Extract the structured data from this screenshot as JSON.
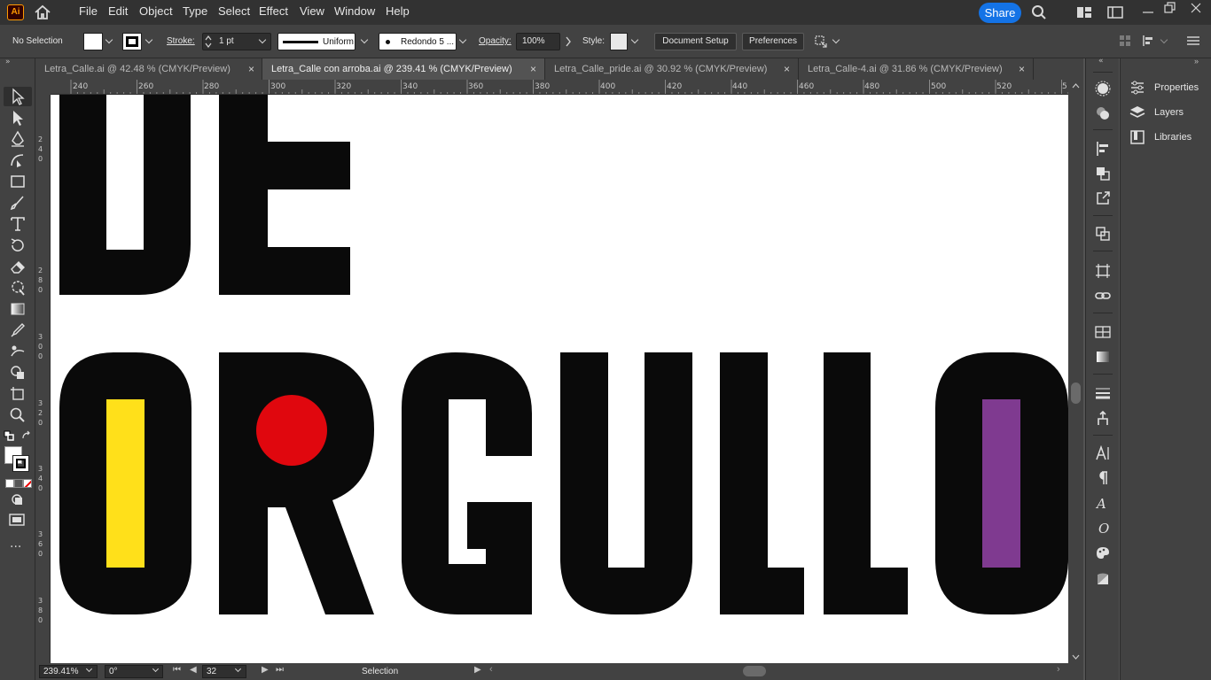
{
  "app": {
    "logo_text": "Ai"
  },
  "menu": [
    "File",
    "Edit",
    "Object",
    "Type",
    "Select",
    "Effect",
    "View",
    "Window",
    "Help"
  ],
  "share_label": "Share",
  "control": {
    "selection": "No Selection",
    "stroke_label": "Stroke:",
    "stroke_value": "1 pt",
    "stroke_profile": "Uniform",
    "brush": "Redondo 5 ...",
    "opacity_label": "Opacity:",
    "opacity_value": "100%",
    "style_label": "Style:",
    "document_setup": "Document Setup",
    "preferences": "Preferences"
  },
  "tabs": [
    {
      "label": "Letra_Calle.ai @ 42.48 % (CMYK/Preview)",
      "active": false
    },
    {
      "label": "Letra_Calle con arroba.ai @ 239.41 % (CMYK/Preview)",
      "active": true
    },
    {
      "label": "Letra_Calle_pride.ai @ 30.92 % (CMYK/Preview)",
      "active": false
    },
    {
      "label": "Letra_Calle-4.ai @ 31.86 % (CMYK/Preview)",
      "active": false
    }
  ],
  "tab_close": "×",
  "ruler_h": [
    "240",
    "260",
    "280",
    "300",
    "320",
    "340",
    "360",
    "380",
    "400",
    "420",
    "440",
    "460",
    "480",
    "500",
    "520",
    "5"
  ],
  "ruler_v": [
    "240",
    "280",
    "300",
    "320",
    "340",
    "360",
    "380"
  ],
  "canvas": {
    "line1": "DE",
    "line2": "ORGULLO",
    "colors": {
      "ink": "#0a0a0a",
      "yellow": "#ffe01a",
      "red": "#e0070e",
      "purple": "#7f3a90"
    }
  },
  "status": {
    "zoom": "239.41%",
    "rotation": "0°",
    "artboard": "32",
    "tool": "Selection"
  },
  "panels": {
    "properties": "Properties",
    "layers": "Layers",
    "libraries": "Libraries"
  }
}
